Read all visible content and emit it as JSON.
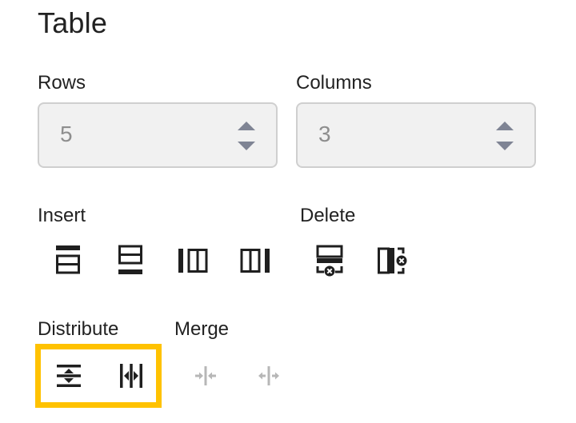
{
  "panel": {
    "title": "Table"
  },
  "rows": {
    "label": "Rows",
    "value": "5"
  },
  "columns": {
    "label": "Columns",
    "value": "3"
  },
  "insert": {
    "label": "Insert",
    "icons": [
      "insert-row-above-icon",
      "insert-row-below-icon",
      "insert-column-left-icon",
      "insert-column-right-icon"
    ]
  },
  "delete": {
    "label": "Delete",
    "icons": [
      "delete-row-icon",
      "delete-column-icon"
    ]
  },
  "distribute": {
    "label": "Distribute",
    "icons": [
      "distribute-rows-icon",
      "distribute-columns-icon"
    ]
  },
  "merge": {
    "label": "Merge",
    "icons": [
      "merge-columns-icon",
      "split-columns-icon"
    ],
    "disabled": true
  },
  "colors": {
    "highlight": "#ffc200",
    "icon": "#1f1f1f",
    "disabled": "#b7b7b7"
  }
}
